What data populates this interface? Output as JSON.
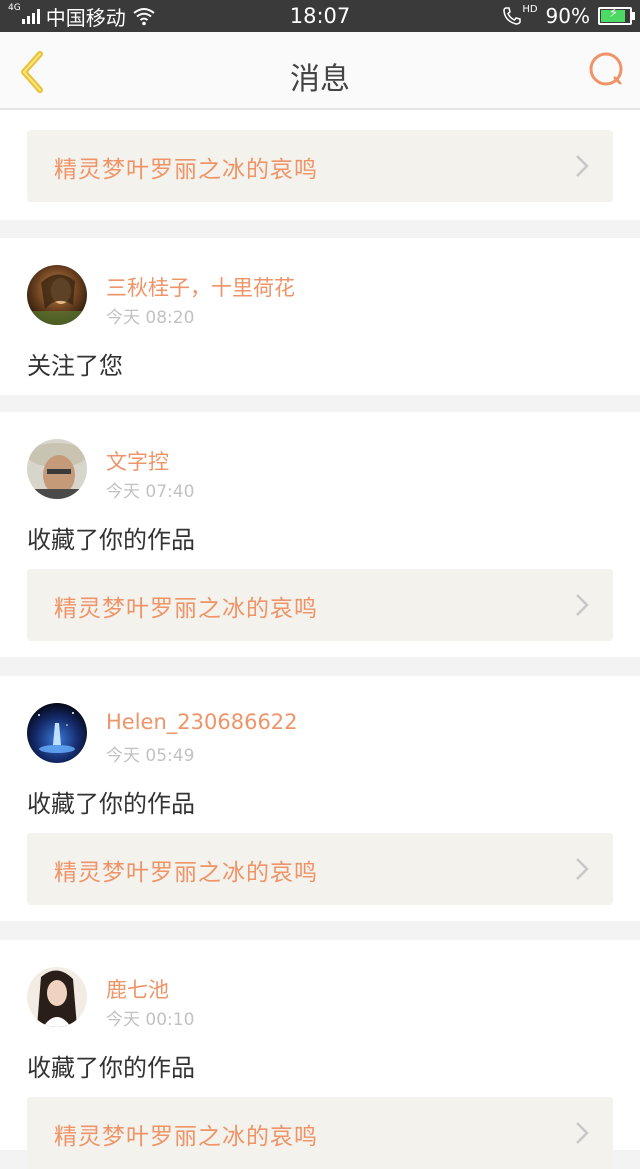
{
  "status_bar": {
    "net_type": "4G",
    "carrier": "中国移动",
    "time": "18:07",
    "hd": "HD",
    "battery": "90%"
  },
  "nav": {
    "title": "消息",
    "back_icon": "chevron-left-icon",
    "search_icon": "search-icon"
  },
  "top_work": {
    "title": "精灵梦叶罗丽之冰的哀鸣"
  },
  "messages": [
    {
      "user": "三秋桂子，十里荷花",
      "time": "今天 08:20",
      "action": "关注了您"
    },
    {
      "user": "文字控",
      "time": "今天 07:40",
      "action": "收藏了你的作品",
      "work": "精灵梦叶罗丽之冰的哀鸣"
    },
    {
      "user": "Helen_230686622",
      "time": "今天 05:49",
      "action": "收藏了你的作品",
      "work": "精灵梦叶罗丽之冰的哀鸣"
    },
    {
      "user": "鹿七池",
      "time": "今天 00:10",
      "action": "收藏了你的作品",
      "work": "精灵梦叶罗丽之冰的哀鸣"
    }
  ],
  "colors": {
    "accent": "#ef9468",
    "back_icon": "#e8c23a",
    "card_link_bg": "#f3f2ec",
    "page_bg": "#f3f3f3"
  }
}
